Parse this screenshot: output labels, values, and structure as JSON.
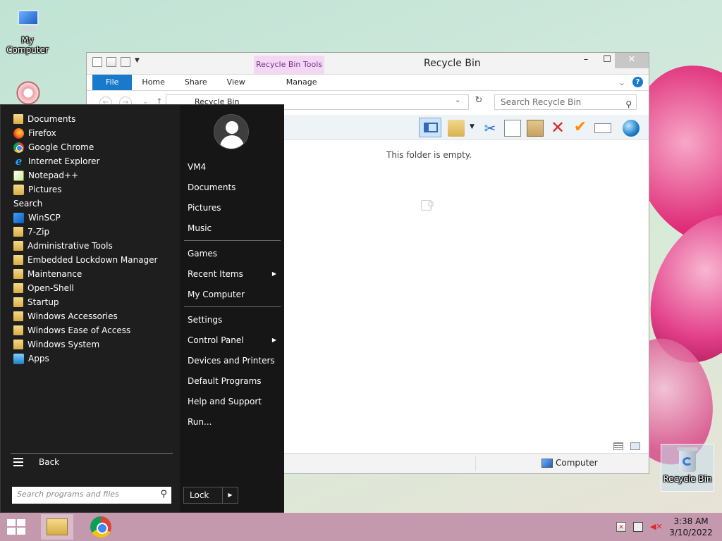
{
  "desktop": {
    "icons": [
      {
        "label": "My Computer"
      },
      {
        "label": "Recycle Bin"
      }
    ]
  },
  "window": {
    "title": "Recycle Bin",
    "contextual_group": "Recycle Bin Tools",
    "ribbon_tabs": [
      "File",
      "Home",
      "Share",
      "View",
      "Manage"
    ],
    "address": "Recycle Bin",
    "search_placeholder": "Search Recycle Bin",
    "empty_message": "This folder is empty.",
    "status_location": "Computer"
  },
  "start_menu": {
    "programs": [
      {
        "label": "Documents",
        "icon": "folder-icon"
      },
      {
        "label": "Firefox",
        "icon": "firefox-icon"
      },
      {
        "label": "Google Chrome",
        "icon": "chrome-icon"
      },
      {
        "label": "Internet Explorer",
        "icon": "internet-explorer-icon"
      },
      {
        "label": "Notepad++",
        "icon": "notepad-plus-plus-icon"
      },
      {
        "label": "Pictures",
        "icon": "pictures-icon"
      },
      {
        "label": "Search",
        "icon": "search-icon"
      },
      {
        "label": "WinSCP",
        "icon": "winscp-icon"
      },
      {
        "label": "7-Zip",
        "icon": "folder-icon"
      },
      {
        "label": "Administrative Tools",
        "icon": "folder-icon"
      },
      {
        "label": "Embedded Lockdown Manager",
        "icon": "folder-icon"
      },
      {
        "label": "Maintenance",
        "icon": "folder-icon"
      },
      {
        "label": "Open-Shell",
        "icon": "folder-icon"
      },
      {
        "label": "Startup",
        "icon": "folder-icon"
      },
      {
        "label": "Windows Accessories",
        "icon": "folder-icon"
      },
      {
        "label": "Windows Ease of Access",
        "icon": "folder-icon"
      },
      {
        "label": "Windows System",
        "icon": "folder-icon"
      },
      {
        "label": "Apps",
        "icon": "apps-icon"
      }
    ],
    "back_label": "Back",
    "search_placeholder": "Search programs and files",
    "right_items": [
      {
        "label": "VM4"
      },
      {
        "label": "Documents"
      },
      {
        "label": "Pictures"
      },
      {
        "label": "Music"
      },
      {
        "label": "Games"
      },
      {
        "label": "Recent Items",
        "submenu": true
      },
      {
        "label": "My Computer"
      },
      {
        "label": "Settings"
      },
      {
        "label": "Control Panel",
        "submenu": true
      },
      {
        "label": "Devices and Printers"
      },
      {
        "label": "Default Programs"
      },
      {
        "label": "Help and Support"
      },
      {
        "label": "Run..."
      }
    ],
    "lock_label": "Lock"
  },
  "taskbar": {
    "time": "3:38 AM",
    "date": "3/10/2022"
  },
  "colors": {
    "file_tab": "#1979ca",
    "contextual_tab": "#f3d7f3",
    "start_menu_bg": "#1e1e1e",
    "taskbar": "#c499ad"
  }
}
